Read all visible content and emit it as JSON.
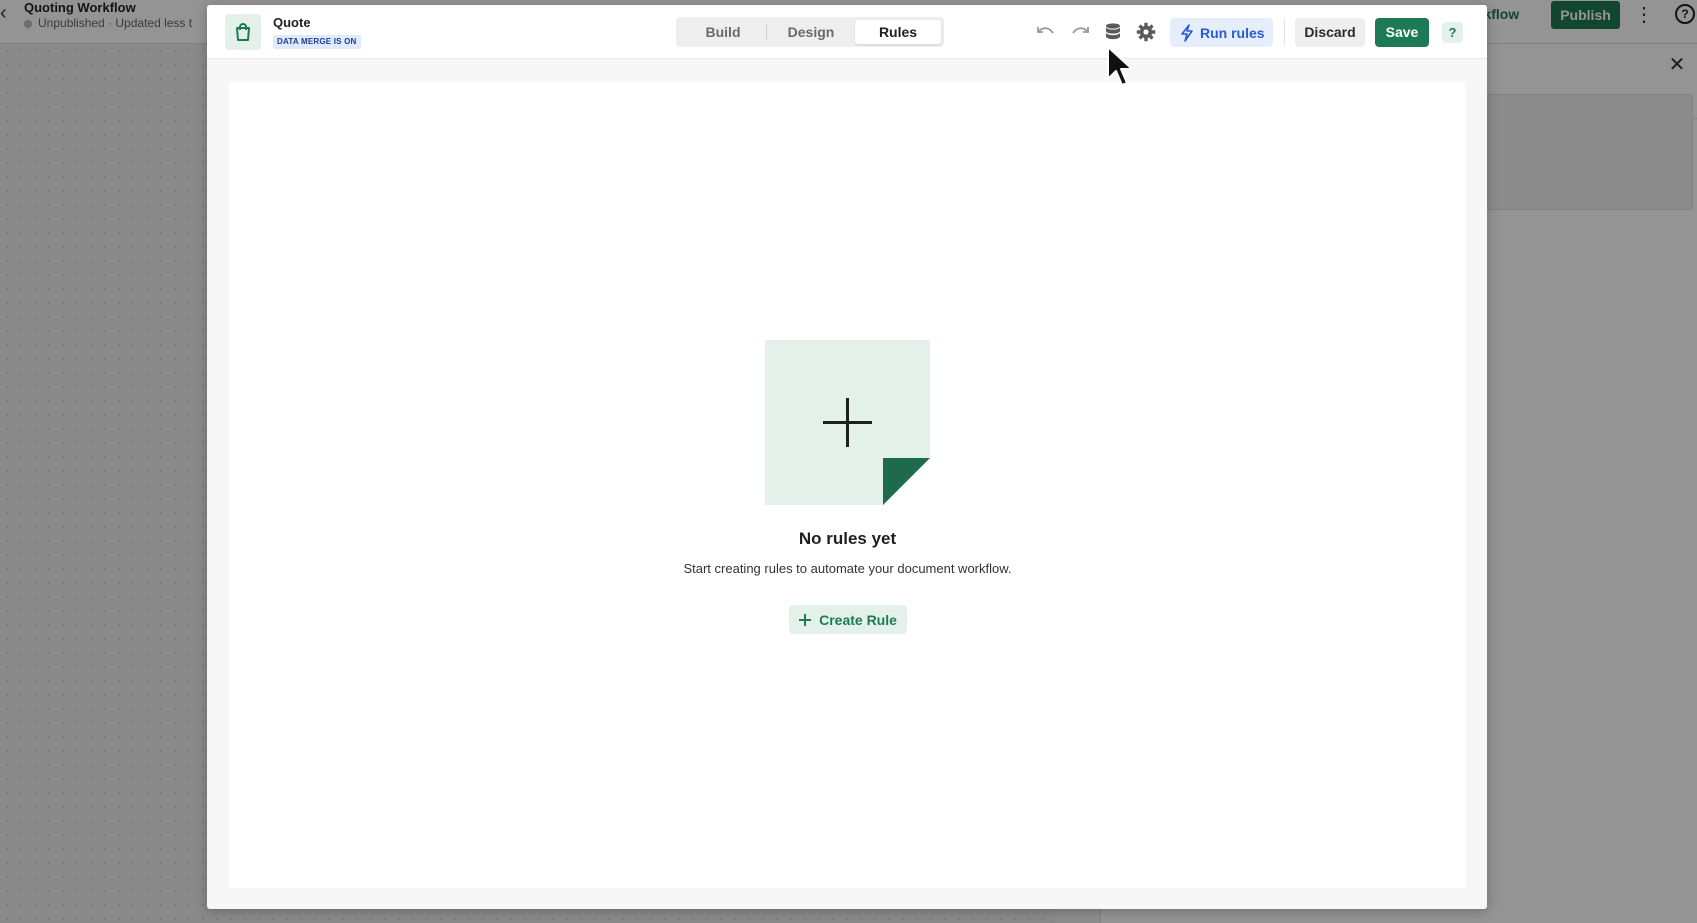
{
  "background": {
    "title": "Quoting Workflow",
    "status": "Unpublished",
    "updated": "Updated less t",
    "workflow_link": "rkflow",
    "publish_label": "Publish"
  },
  "modal": {
    "doc_title": "Quote",
    "data_merge_badge": "DATA MERGE IS ON",
    "tabs": [
      {
        "label": "Build",
        "active": false
      },
      {
        "label": "Design",
        "active": false
      },
      {
        "label": "Rules",
        "active": true
      }
    ],
    "run_rules_label": "Run rules",
    "discard_label": "Discard",
    "save_label": "Save",
    "help_label": "?",
    "icons": {
      "undo": "undo-icon",
      "redo": "redo-icon",
      "data": "database-icon",
      "settings": "gear-icon",
      "run": "lightning-bolt-icon",
      "document": "shopping-bag-icon"
    }
  },
  "empty_state": {
    "title": "No rules yet",
    "subtitle": "Start creating rules to automate your document workflow.",
    "create_label": "Create Rule"
  },
  "colors": {
    "brand_green": "#1e7a55",
    "light_green": "#e4f1ea",
    "run_blue": "#2a5bd0",
    "run_blue_bg": "#e6eefc"
  }
}
